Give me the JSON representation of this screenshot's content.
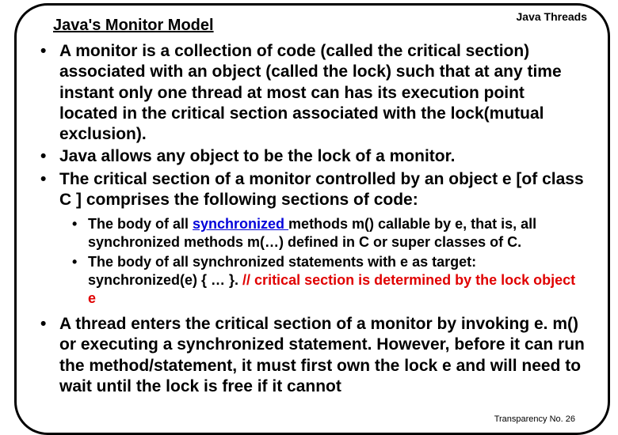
{
  "header": {
    "title": "Java's  Monitor Model",
    "chapter": "Java Threads"
  },
  "bullets": {
    "p1": "A monitor is a collection of code (called the critical  section) associated with an object (called the lock) such that at any time instant only one thread at most can has its execution point  located in the critical section associated with the lock(mutual exclusion).",
    "p2": "Java allows any object to be the lock of a monitor.",
    "p3": "The critical section of a monitor controlled by an object e [of class C ] comprises the following sections of code:",
    "s1a": "The body of all ",
    "s1syn": "synchronized ",
    "s1b": "methods m() callable by e, that is, all synchronized methods m(…) defined in C or super classes of C.",
    "s2a": "The body of all synchronized statements with e as target: synchronized(e) { …  }. ",
    "s2b": " // critical section is determined by the lock object e",
    "p4": "A thread enters the critical section of a monitor by invoking e. m() or executing a synchronized statement. However, before it can run the method/statement, it must first own the lock e and will need to wait until the lock is free if it cannot"
  },
  "footer": {
    "pagenum": "Transparency No. 26"
  }
}
